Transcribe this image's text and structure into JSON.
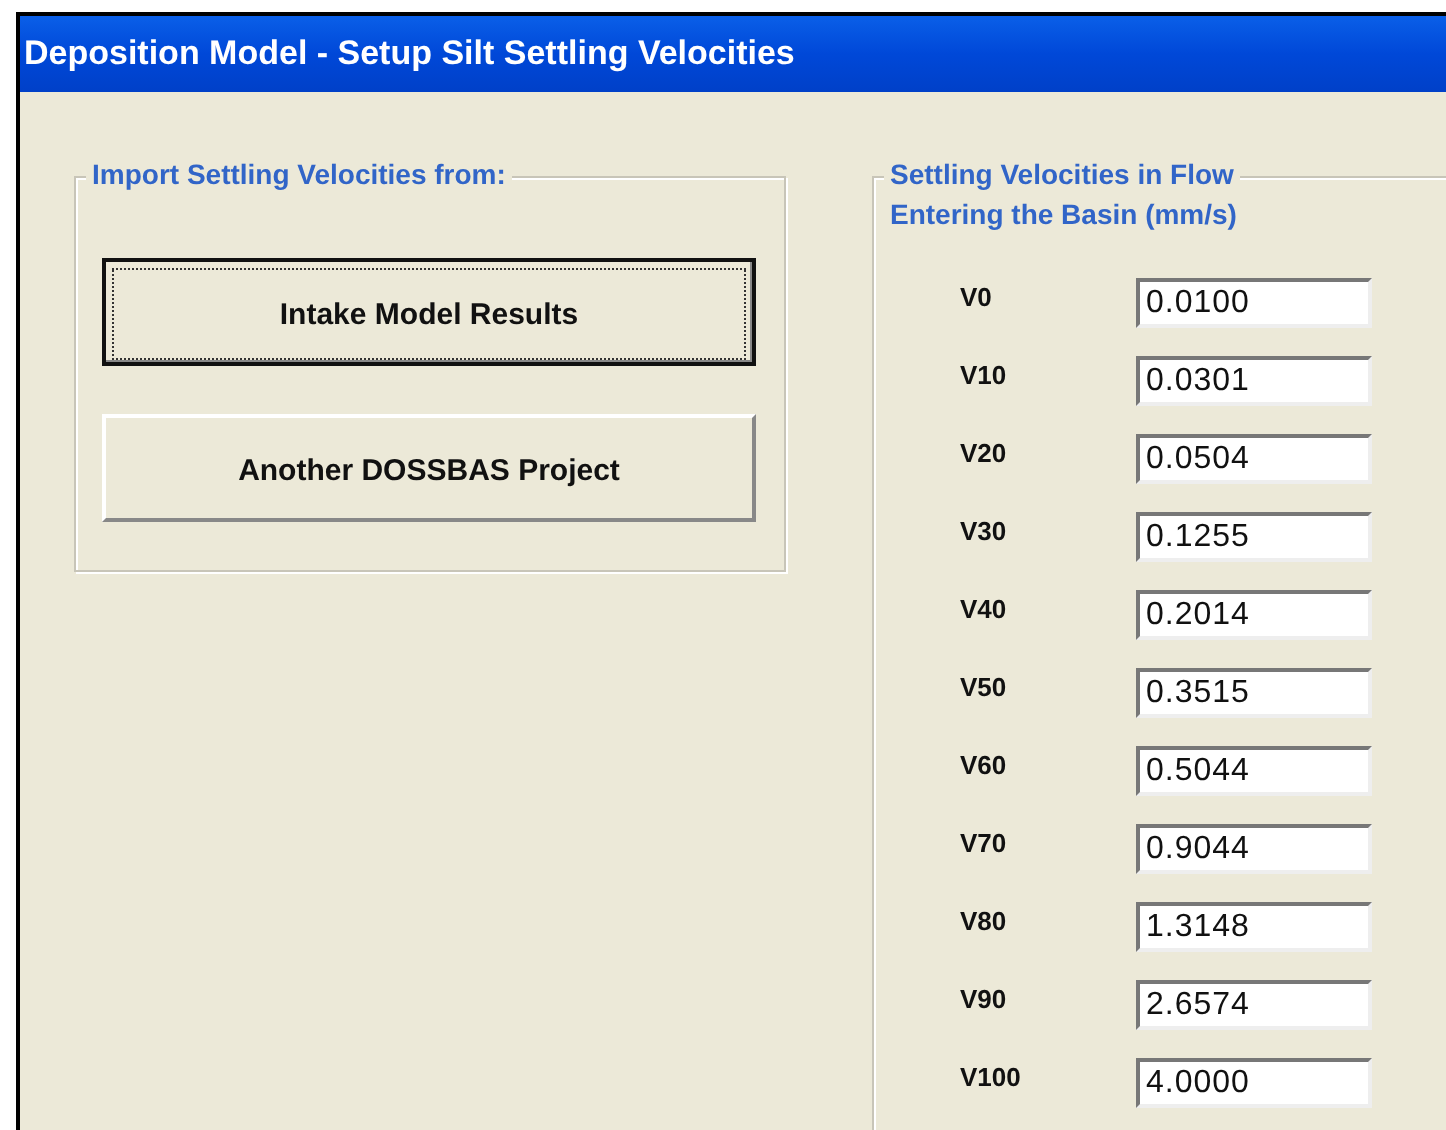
{
  "window": {
    "title": "Deposition Model - Setup Silt Settling Velocities"
  },
  "import_group": {
    "title": "Import Settling Velocities from:",
    "buttons": [
      {
        "label": "Intake Model Results",
        "focused": true
      },
      {
        "label": "Another DOSSBAS Project",
        "focused": false
      }
    ]
  },
  "velocities_group": {
    "title_lines": [
      "Settling Velocities in Flow",
      "Entering the Basin (mm/s)"
    ],
    "fields": [
      {
        "label": "V0",
        "value": "0.0100"
      },
      {
        "label": "V10",
        "value": "0.0301"
      },
      {
        "label": "V20",
        "value": "0.0504"
      },
      {
        "label": "V30",
        "value": "0.1255"
      },
      {
        "label": "V40",
        "value": "0.2014"
      },
      {
        "label": "V50",
        "value": "0.3515"
      },
      {
        "label": "V60",
        "value": "0.5044"
      },
      {
        "label": "V70",
        "value": "0.9044"
      },
      {
        "label": "V80",
        "value": "1.3148"
      },
      {
        "label": "V90",
        "value": "2.6574"
      },
      {
        "label": "V100",
        "value": "4.0000"
      }
    ]
  }
}
